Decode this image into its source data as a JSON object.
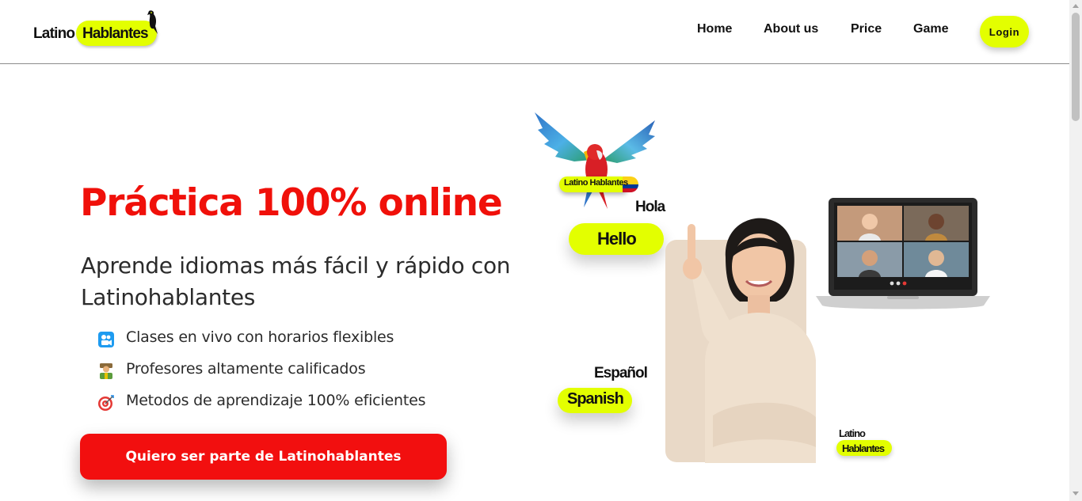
{
  "brand": {
    "name_part1": "Latino",
    "name_part2": "Hablantes",
    "accent_color": "#e3ff00",
    "primary_color": "#f20f0f"
  },
  "nav": {
    "links": [
      "Home",
      "About us",
      "Price",
      "Game"
    ],
    "login_label": "Login"
  },
  "hero": {
    "title": "Práctica 100% online",
    "subtitle": "Aprende idiomas más fácil y rápido con Latinohablantes",
    "features": [
      {
        "icon": "video-camera-icon",
        "text": "Clases en vivo con horarios flexibles"
      },
      {
        "icon": "teacher-icon",
        "text": "Profesores altamente calificados"
      },
      {
        "icon": "target-icon",
        "text": "Metodos de aprendizaje 100% eficientes"
      }
    ],
    "cta_label": "Quiero ser parte de Latinohablantes"
  },
  "illustration": {
    "parrot_badge": "Latino Hablantes",
    "word_hola": "Hola",
    "word_hello": "Hello",
    "word_espanol": "Español",
    "word_spanish": "Spanish",
    "small_logo_part1": "Latino",
    "small_logo_part2": "Hablantes"
  }
}
